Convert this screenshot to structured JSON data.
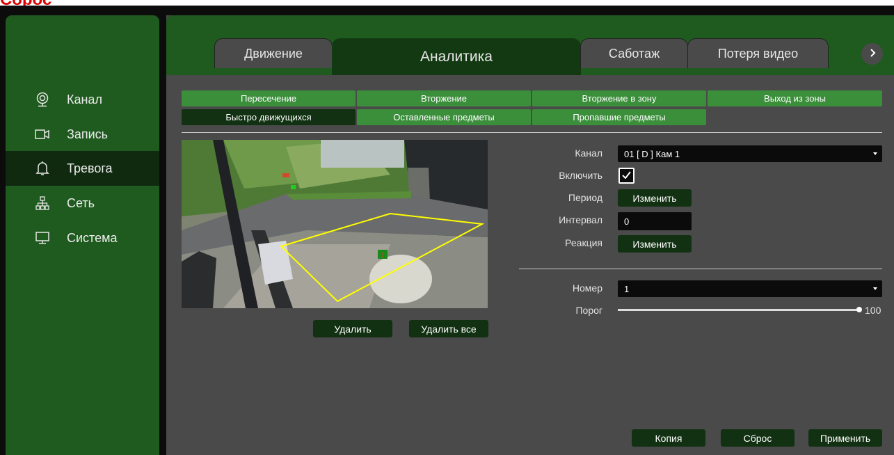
{
  "cut_text": "Сброс",
  "sidebar": {
    "items": [
      {
        "label": "Канал",
        "icon": "camera-icon",
        "active": false
      },
      {
        "label": "Запись",
        "icon": "video-recorder-icon",
        "active": false
      },
      {
        "label": "Тревога",
        "icon": "bell-icon",
        "active": true
      },
      {
        "label": "Сеть",
        "icon": "network-icon",
        "active": false
      },
      {
        "label": "Система",
        "icon": "monitor-icon",
        "active": false
      }
    ]
  },
  "tabs": [
    {
      "label": "Движение",
      "active": false
    },
    {
      "label": "Аналитика",
      "active": true
    },
    {
      "label": "Саботаж",
      "active": false
    },
    {
      "label": "Потеря видео",
      "active": false
    }
  ],
  "zone_buttons": [
    {
      "label": "Пересечение",
      "active": false
    },
    {
      "label": "Вторжение",
      "active": false
    },
    {
      "label": "Вторжение в зону",
      "active": false
    },
    {
      "label": "Выход из зоны",
      "active": false
    },
    {
      "label": "Быстро движущихся",
      "active": true
    },
    {
      "label": "Оставленные предметы",
      "active": false
    },
    {
      "label": "Пропавшие предметы",
      "active": false
    }
  ],
  "video": {
    "zone_marker": "1",
    "zone_color": "#ffff00",
    "delete_label": "Удалить",
    "delete_all_label": "Удалить все"
  },
  "form": {
    "channel_label": "Канал",
    "channel_value": "01 [ D ] Кам 1",
    "enable_label": "Включить",
    "enable_checked": true,
    "period_label": "Период",
    "period_button": "Изменить",
    "interval_label": "Интервал",
    "interval_value": "0",
    "reaction_label": "Реакция",
    "reaction_button": "Изменить",
    "number_label": "Номер",
    "number_value": "1",
    "threshold_label": "Порог",
    "threshold_value": "100"
  },
  "footer": {
    "copy_label": "Копия",
    "reset_label": "Сброс",
    "apply_label": "Применить"
  },
  "colors": {
    "sidebar_bg": "#1f5a1f",
    "active_dark": "#123112",
    "zone_btn": "#3b8f3b",
    "panel_bg": "#4a4a4a"
  }
}
